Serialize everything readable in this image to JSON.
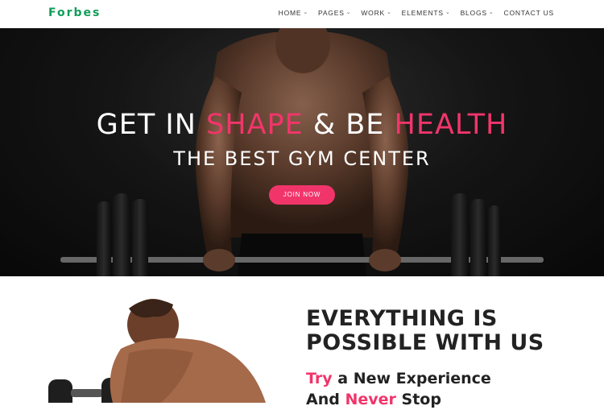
{
  "brand": {
    "logo": "Forbes"
  },
  "nav": {
    "items": [
      {
        "label": "HOME",
        "dropdown": true
      },
      {
        "label": "PAGES",
        "dropdown": true
      },
      {
        "label": "WORK",
        "dropdown": true
      },
      {
        "label": "ELEMENTS",
        "dropdown": true
      },
      {
        "label": "BLOGS",
        "dropdown": true
      },
      {
        "label": "CONTACT US",
        "dropdown": false
      }
    ]
  },
  "hero": {
    "headline_part1": "GET IN ",
    "headline_highlight1": "SHAPE",
    "headline_part2": " & BE ",
    "headline_highlight2": "HEALTH",
    "subheadline": "THE BEST GYM CENTER",
    "cta_label": "JOIN NOW"
  },
  "about": {
    "title_line1": "EVERYTHING IS",
    "title_line2": "POSSIBLE WITH US",
    "sub_highlight1": "Try",
    "sub_text1": " a New Experience",
    "sub_text2": "And ",
    "sub_highlight2": "Never",
    "sub_text3": " Stop"
  },
  "colors": {
    "accent": "#f1356b",
    "brand": "#0f9d58",
    "text_dark": "#222222",
    "hero_bg": "#111111"
  }
}
